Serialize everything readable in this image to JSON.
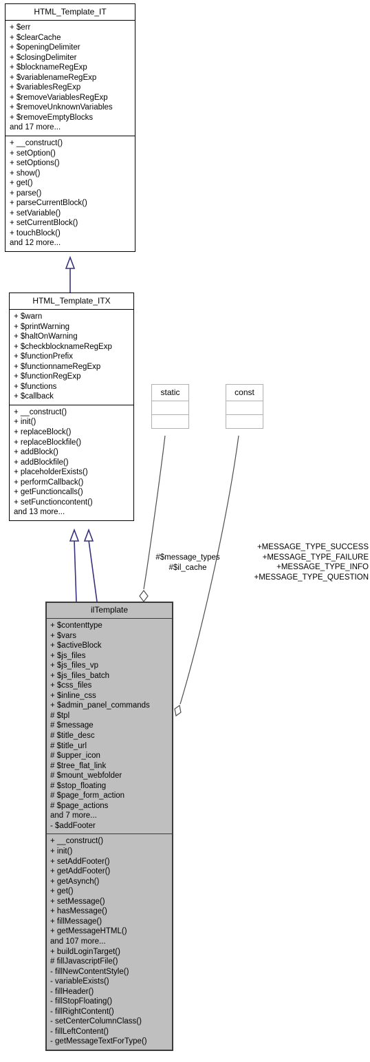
{
  "diagram": {
    "type": "uml-class-diagram",
    "background": "#ffffff",
    "inheritance_color": "#37307c",
    "association_color": "#4d4d4d",
    "highlight_fill": "#bfbfbf"
  },
  "classes": {
    "html_template_it": {
      "name": "HTML_Template_IT",
      "attributes": [
        "+ $err",
        "+ $clearCache",
        "+ $openingDelimiter",
        "+ $closingDelimiter",
        "+ $blocknameRegExp",
        "+ $variablenameRegExp",
        "+ $variablesRegExp",
        "+ $removeVariablesRegExp",
        "+ $removeUnknownVariables",
        "+ $removeEmptyBlocks",
        "and 17 more..."
      ],
      "methods": [
        "+ __construct()",
        "+ setOption()",
        "+ setOptions()",
        "+ show()",
        "+ get()",
        "+ parse()",
        "+ parseCurrentBlock()",
        "+ setVariable()",
        "+ setCurrentBlock()",
        "+ touchBlock()",
        "and 12 more..."
      ]
    },
    "html_template_itx": {
      "name": "HTML_Template_ITX",
      "attributes": [
        "+ $warn",
        "+ $printWarning",
        "+ $haltOnWarning",
        "+ $checkblocknameRegExp",
        "+ $functionPrefix",
        "+ $functionnameRegExp",
        "+ $functionRegExp",
        "+ $functions",
        "+ $callback"
      ],
      "methods": [
        "+ __construct()",
        "+ init()",
        "+ replaceBlock()",
        "+ replaceBlockfile()",
        "+ addBlock()",
        "+ addBlockfile()",
        "+ placeholderExists()",
        "+ performCallback()",
        "+ getFunctioncalls()",
        "+ setFunctioncontent()",
        "and 13 more..."
      ]
    },
    "static_box": {
      "name": "static",
      "attributes": [],
      "methods": []
    },
    "const_box": {
      "name": "const",
      "attributes": [],
      "methods": []
    },
    "il_template": {
      "name": "ilTemplate",
      "attributes": [
        "+ $contenttype",
        "+ $vars",
        "+ $activeBlock",
        "+ $js_files",
        "+ $js_files_vp",
        "+ $js_files_batch",
        "+ $css_files",
        "+ $inline_css",
        "+ $admin_panel_commands",
        "# $tpl",
        "# $message",
        "# $title_desc",
        "# $title_url",
        "# $upper_icon",
        "# $tree_flat_link",
        "# $mount_webfolder",
        "# $stop_floating",
        "# $page_form_action",
        "# $page_actions",
        "and 7 more...",
        "- $addFooter"
      ],
      "methods": [
        "+ __construct()",
        "+ init()",
        "+ setAddFooter()",
        "+ getAddFooter()",
        "+ getAsynch()",
        "+ get()",
        "+ setMessage()",
        "+ hasMessage()",
        "+ fillMessage()",
        "+ getMessageHTML()",
        "and 107 more...",
        "+ buildLoginTarget()",
        "# fillJavascriptFile()",
        "- fillNewContentStyle()",
        "- variableExists()",
        "- fillHeader()",
        "- fillStopFloating()",
        "- fillRightContent()",
        "- setCenterColumnClass()",
        "- fillLeftContent()",
        "- getMessageTextForType()"
      ]
    }
  },
  "edge_labels": {
    "static_assoc": "#$message_types\n#$il_cache",
    "const_assoc": "+MESSAGE_TYPE_SUCCESS\n+MESSAGE_TYPE_FAILURE\n+MESSAGE_TYPE_INFO\n+MESSAGE_TYPE_QUESTION"
  }
}
